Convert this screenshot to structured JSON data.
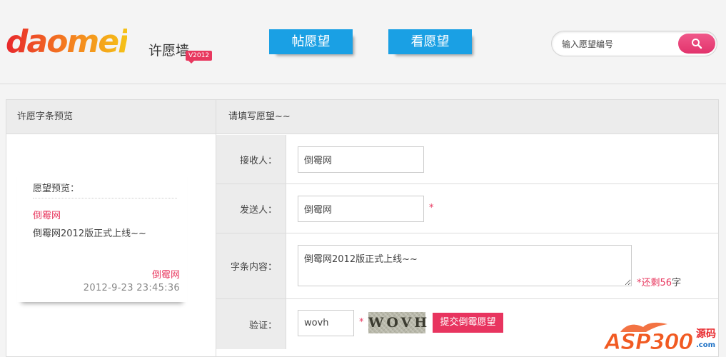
{
  "header": {
    "logo_text": "daomei",
    "logo_subtitle": "许愿墙",
    "version_badge": "V2012",
    "nav": [
      {
        "label": "帖愿望"
      },
      {
        "label": "看愿望"
      }
    ],
    "search": {
      "placeholder": "输入愿望编号",
      "icon": "search-icon"
    }
  },
  "preview": {
    "heading": "许愿字条预览",
    "label": "愿望预览：",
    "recipient": "倒霉网",
    "content": "倒霉网2012版正式上线~~",
    "sender": "倒霉网",
    "time": "2012-9-23 23:45:36"
  },
  "form": {
    "heading": "请填写愿望~~",
    "recipient_label": "接收人：",
    "recipient_value": "倒霉网",
    "sender_label": "发送人：",
    "sender_value": "倒霉网",
    "content_label": "字条内容：",
    "content_value": "倒霉网2012版正式上线~~",
    "required_mark": "*",
    "remain_prefix": "*还剩",
    "remain_count": "56",
    "remain_suffix": "字",
    "verify_label": "验证：",
    "verify_value": "wovh",
    "captcha_text": "WOVH",
    "submit_label": "提交倒霉愿望"
  },
  "watermark": {
    "text": "ASP300",
    "side_top": "源码",
    "side_bottom": ".com"
  },
  "colors": {
    "accent_pink": "#e8385f",
    "nav_blue": "#1aa0e4",
    "logo_orange": "#f47c20"
  }
}
